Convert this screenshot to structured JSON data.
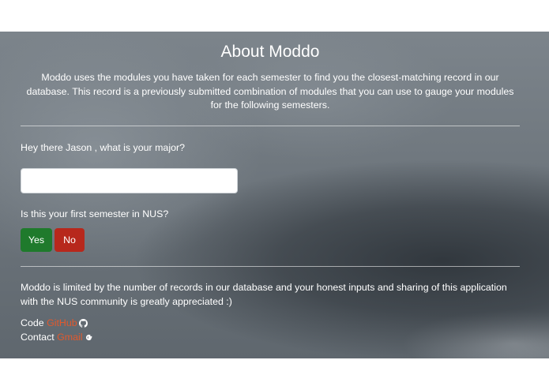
{
  "about": {
    "title": "About Moddo",
    "description": "Moddo uses the modules you have taken for each semester to find you the closest-matching record in our database. This record is a previously submitted combination of modules that you can use to gauge your modules for the following semesters."
  },
  "form": {
    "major_question": "Hey there Jason , what is your major?",
    "major_value": "",
    "first_sem_question": "Is this your first semester in NUS?",
    "yes_label": "Yes",
    "no_label": "No"
  },
  "footer": {
    "note": "Moddo is limited by the number of records in our database and your honest inputs and sharing of this application with the NUS community is greatly appreciated :)",
    "code_label": "Code",
    "code_link": "GitHub",
    "code_icon": "github-icon",
    "contact_label": "Contact",
    "contact_link": "Gmail",
    "contact_icon": "google-icon"
  },
  "colors": {
    "yes_button": "#1f7a2c",
    "no_button": "#b7281c",
    "link": "#e2592d"
  }
}
